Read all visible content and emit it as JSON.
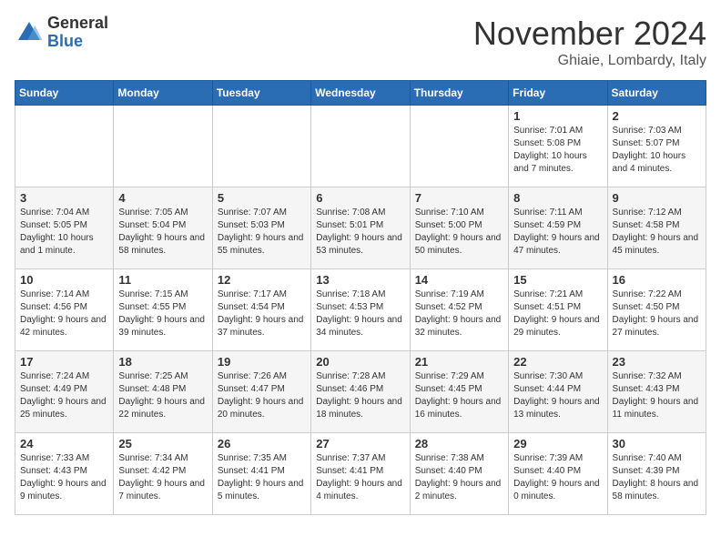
{
  "header": {
    "logo_general": "General",
    "logo_blue": "Blue",
    "month_title": "November 2024",
    "location": "Ghiaie, Lombardy, Italy"
  },
  "days_of_week": [
    "Sunday",
    "Monday",
    "Tuesday",
    "Wednesday",
    "Thursday",
    "Friday",
    "Saturday"
  ],
  "weeks": [
    [
      {
        "day": "",
        "info": ""
      },
      {
        "day": "",
        "info": ""
      },
      {
        "day": "",
        "info": ""
      },
      {
        "day": "",
        "info": ""
      },
      {
        "day": "",
        "info": ""
      },
      {
        "day": "1",
        "info": "Sunrise: 7:01 AM\nSunset: 5:08 PM\nDaylight: 10 hours and 7 minutes."
      },
      {
        "day": "2",
        "info": "Sunrise: 7:03 AM\nSunset: 5:07 PM\nDaylight: 10 hours and 4 minutes."
      }
    ],
    [
      {
        "day": "3",
        "info": "Sunrise: 7:04 AM\nSunset: 5:05 PM\nDaylight: 10 hours and 1 minute."
      },
      {
        "day": "4",
        "info": "Sunrise: 7:05 AM\nSunset: 5:04 PM\nDaylight: 9 hours and 58 minutes."
      },
      {
        "day": "5",
        "info": "Sunrise: 7:07 AM\nSunset: 5:03 PM\nDaylight: 9 hours and 55 minutes."
      },
      {
        "day": "6",
        "info": "Sunrise: 7:08 AM\nSunset: 5:01 PM\nDaylight: 9 hours and 53 minutes."
      },
      {
        "day": "7",
        "info": "Sunrise: 7:10 AM\nSunset: 5:00 PM\nDaylight: 9 hours and 50 minutes."
      },
      {
        "day": "8",
        "info": "Sunrise: 7:11 AM\nSunset: 4:59 PM\nDaylight: 9 hours and 47 minutes."
      },
      {
        "day": "9",
        "info": "Sunrise: 7:12 AM\nSunset: 4:58 PM\nDaylight: 9 hours and 45 minutes."
      }
    ],
    [
      {
        "day": "10",
        "info": "Sunrise: 7:14 AM\nSunset: 4:56 PM\nDaylight: 9 hours and 42 minutes."
      },
      {
        "day": "11",
        "info": "Sunrise: 7:15 AM\nSunset: 4:55 PM\nDaylight: 9 hours and 39 minutes."
      },
      {
        "day": "12",
        "info": "Sunrise: 7:17 AM\nSunset: 4:54 PM\nDaylight: 9 hours and 37 minutes."
      },
      {
        "day": "13",
        "info": "Sunrise: 7:18 AM\nSunset: 4:53 PM\nDaylight: 9 hours and 34 minutes."
      },
      {
        "day": "14",
        "info": "Sunrise: 7:19 AM\nSunset: 4:52 PM\nDaylight: 9 hours and 32 minutes."
      },
      {
        "day": "15",
        "info": "Sunrise: 7:21 AM\nSunset: 4:51 PM\nDaylight: 9 hours and 29 minutes."
      },
      {
        "day": "16",
        "info": "Sunrise: 7:22 AM\nSunset: 4:50 PM\nDaylight: 9 hours and 27 minutes."
      }
    ],
    [
      {
        "day": "17",
        "info": "Sunrise: 7:24 AM\nSunset: 4:49 PM\nDaylight: 9 hours and 25 minutes."
      },
      {
        "day": "18",
        "info": "Sunrise: 7:25 AM\nSunset: 4:48 PM\nDaylight: 9 hours and 22 minutes."
      },
      {
        "day": "19",
        "info": "Sunrise: 7:26 AM\nSunset: 4:47 PM\nDaylight: 9 hours and 20 minutes."
      },
      {
        "day": "20",
        "info": "Sunrise: 7:28 AM\nSunset: 4:46 PM\nDaylight: 9 hours and 18 minutes."
      },
      {
        "day": "21",
        "info": "Sunrise: 7:29 AM\nSunset: 4:45 PM\nDaylight: 9 hours and 16 minutes."
      },
      {
        "day": "22",
        "info": "Sunrise: 7:30 AM\nSunset: 4:44 PM\nDaylight: 9 hours and 13 minutes."
      },
      {
        "day": "23",
        "info": "Sunrise: 7:32 AM\nSunset: 4:43 PM\nDaylight: 9 hours and 11 minutes."
      }
    ],
    [
      {
        "day": "24",
        "info": "Sunrise: 7:33 AM\nSunset: 4:43 PM\nDaylight: 9 hours and 9 minutes."
      },
      {
        "day": "25",
        "info": "Sunrise: 7:34 AM\nSunset: 4:42 PM\nDaylight: 9 hours and 7 minutes."
      },
      {
        "day": "26",
        "info": "Sunrise: 7:35 AM\nSunset: 4:41 PM\nDaylight: 9 hours and 5 minutes."
      },
      {
        "day": "27",
        "info": "Sunrise: 7:37 AM\nSunset: 4:41 PM\nDaylight: 9 hours and 4 minutes."
      },
      {
        "day": "28",
        "info": "Sunrise: 7:38 AM\nSunset: 4:40 PM\nDaylight: 9 hours and 2 minutes."
      },
      {
        "day": "29",
        "info": "Sunrise: 7:39 AM\nSunset: 4:40 PM\nDaylight: 9 hours and 0 minutes."
      },
      {
        "day": "30",
        "info": "Sunrise: 7:40 AM\nSunset: 4:39 PM\nDaylight: 8 hours and 58 minutes."
      }
    ]
  ]
}
